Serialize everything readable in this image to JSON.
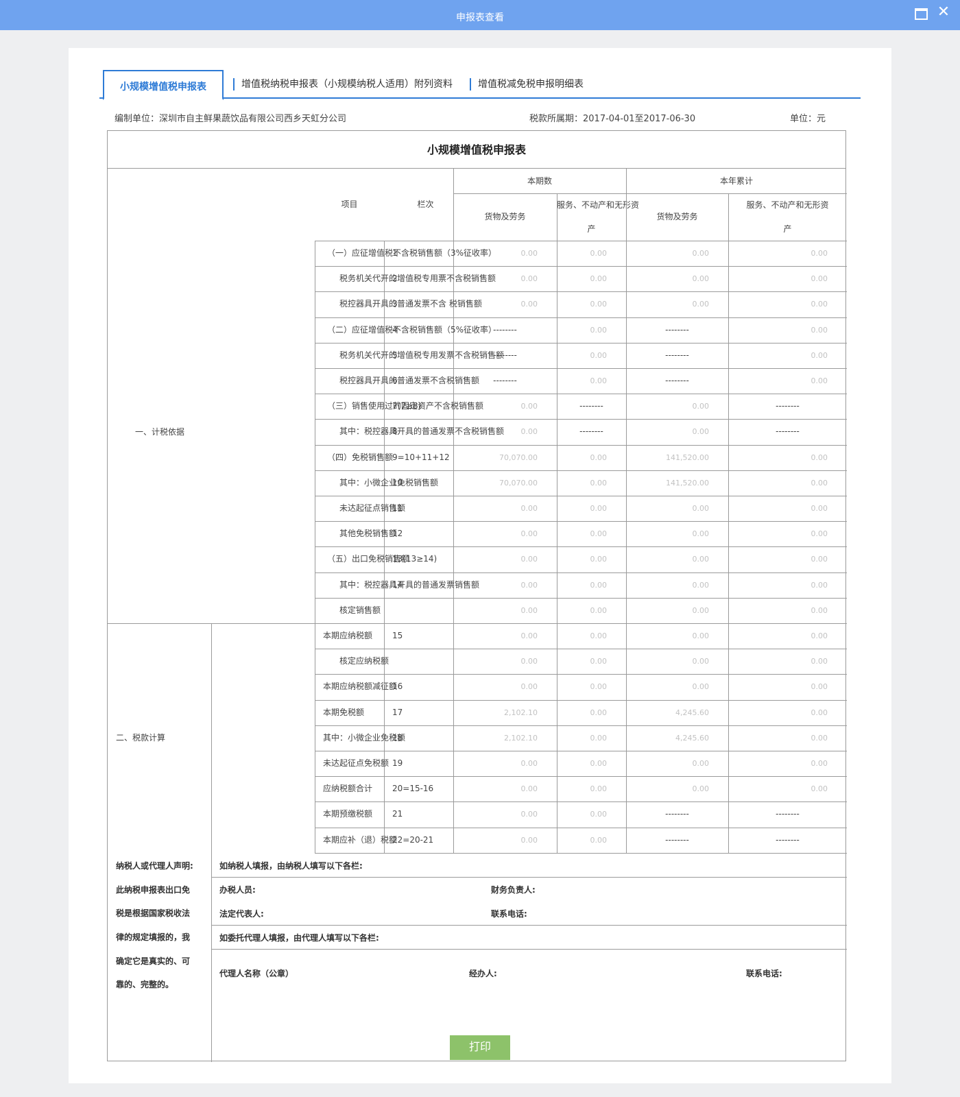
{
  "window": {
    "title": "申报表查看"
  },
  "tabs": [
    {
      "label": "小规模增值税申报表"
    },
    {
      "label": "增值税纳税申报表（小规模纳税人适用）附列资料"
    },
    {
      "label": "增值税减免税申报明细表"
    }
  ],
  "info": {
    "unit_label": "编制单位：深圳市自主鲜果蔬饮品有限公司西乡天虹分公司",
    "period_label": "税款所属期：2017-04-01至2017-06-30",
    "currency_label": "单位：元"
  },
  "form": {
    "title": "小规模增值税申报表",
    "headers": {
      "item": "项目",
      "line_no": "栏次",
      "current": "本期数",
      "ytd": "本年累计",
      "goods": "货物及劳务",
      "services_line1": "服务、不动产和无形资",
      "services_line2": "产"
    },
    "section1": "一、计税依据",
    "section2": "二、税款计算",
    "rows": [
      {
        "item": "（一）应征增值税不含税销售额（3%征收率）",
        "indent": 0,
        "no": "1",
        "v": [
          "0.00",
          "0.00",
          "0.00",
          "0.00"
        ]
      },
      {
        "item": "税务机关代开的增值税专用票不含税销售额",
        "indent": 1,
        "no": "2",
        "v": [
          "0.00",
          "0.00",
          "0.00",
          "0.00"
        ]
      },
      {
        "item": "税控器具开具的普通发票不含 税销售额",
        "indent": 1,
        "no": "3",
        "v": [
          "0.00",
          "0.00",
          "0.00",
          "0.00"
        ]
      },
      {
        "item": "（二）应征增值税不含税销售额（5%征收率）",
        "indent": 0,
        "no": "4",
        "v": [
          "--------",
          "0.00",
          "--------",
          "0.00"
        ]
      },
      {
        "item": "税务机关代开的增值税专用发票不含税销售额",
        "indent": 1,
        "no": "5",
        "v": [
          "--------",
          "0.00",
          "--------",
          "0.00"
        ]
      },
      {
        "item": "税控器具开具的普通发票不含税销售额",
        "indent": 1,
        "no": "6",
        "v": [
          "--------",
          "0.00",
          "--------",
          "0.00"
        ]
      },
      {
        "item": "（三）销售使用过的固定资产不含税销售额",
        "indent": 0,
        "no": "7(7≥8)",
        "v": [
          "0.00",
          "--------",
          "0.00",
          "--------"
        ]
      },
      {
        "item": "其中：税控器具开具的普通发票不含税销售额",
        "indent": 1,
        "no": "8",
        "v": [
          "0.00",
          "--------",
          "0.00",
          "--------"
        ]
      },
      {
        "item": "（四）免税销售额",
        "indent": 0,
        "no": "9=10+11+12",
        "v": [
          "70,070.00",
          "0.00",
          "141,520.00",
          "0.00"
        ]
      },
      {
        "item": "其中：小微企业免税销售额",
        "indent": 1,
        "no": "10",
        "v": [
          "70,070.00",
          "0.00",
          "141,520.00",
          "0.00"
        ]
      },
      {
        "item": "未达起征点销售额",
        "indent": 1,
        "no": "11",
        "v": [
          "0.00",
          "0.00",
          "0.00",
          "0.00"
        ]
      },
      {
        "item": "其他免税销售额",
        "indent": 1,
        "no": "12",
        "v": [
          "0.00",
          "0.00",
          "0.00",
          "0.00"
        ]
      },
      {
        "item": "（五）出口免税销售额",
        "indent": 0,
        "no": "13(13≥14)",
        "v": [
          "0.00",
          "0.00",
          "0.00",
          "0.00"
        ]
      },
      {
        "item": "其中：税控器具开具的普通发票销售额",
        "indent": 1,
        "no": "14",
        "v": [
          "0.00",
          "0.00",
          "0.00",
          "0.00"
        ]
      },
      {
        "item": "核定销售额",
        "indent": 1,
        "no": "",
        "v": [
          "0.00",
          "0.00",
          "0.00",
          "0.00"
        ]
      },
      {
        "item": "本期应纳税额",
        "indent": -1,
        "no": "15",
        "v": [
          "0.00",
          "0.00",
          "0.00",
          "0.00"
        ]
      },
      {
        "item": "核定应纳税额",
        "indent": 1,
        "no": "",
        "v": [
          "0.00",
          "0.00",
          "0.00",
          "0.00"
        ]
      },
      {
        "item": "本期应纳税额减征额",
        "indent": -1,
        "no": "16",
        "v": [
          "0.00",
          "0.00",
          "0.00",
          "0.00"
        ]
      },
      {
        "item": "本期免税额",
        "indent": -1,
        "no": "17",
        "v": [
          "2,102.10",
          "0.00",
          "4,245.60",
          "0.00"
        ]
      },
      {
        "item": "其中：小微企业免税额",
        "indent": -1,
        "no": "18",
        "v": [
          "2,102.10",
          "0.00",
          "4,245.60",
          "0.00"
        ]
      },
      {
        "item": "未达起征点免税额",
        "indent": -1,
        "no": "19",
        "v": [
          "0.00",
          "0.00",
          "0.00",
          "0.00"
        ]
      },
      {
        "item": "应纳税额合计",
        "indent": -1,
        "no": "20=15-16",
        "v": [
          "0.00",
          "0.00",
          "0.00",
          "0.00"
        ]
      },
      {
        "item": "本期预缴税额",
        "indent": -1,
        "no": "21",
        "v": [
          "0.00",
          "0.00",
          "--------",
          "--------"
        ]
      },
      {
        "item": "本期应补（退）税额",
        "indent": -1,
        "no": "22=20-21",
        "v": [
          "0.00",
          "0.00",
          "--------",
          "--------"
        ]
      }
    ],
    "declaration": {
      "left_lines": [
        "纳税人或代理人声明:",
        "此纳税申报表出口免",
        "税是根据国家税收法",
        "律的规定填报的，我",
        "确定它是真实的、可",
        "靠的、完整的。"
      ],
      "self_filing": "如纳税人填报，由纳税人填写以下各栏:",
      "tax_officer": "办税人员:",
      "finance_head": "财务负责人:",
      "legal_rep": "法定代表人:",
      "phone": "联系电话:",
      "agent_filing": "如委托代理人填报，由代理人填写以下各栏:",
      "agent_name": "代理人名称（公章）",
      "handler": "经办人:",
      "agent_phone": "联系电话:"
    }
  },
  "actions": {
    "print": "打印"
  }
}
